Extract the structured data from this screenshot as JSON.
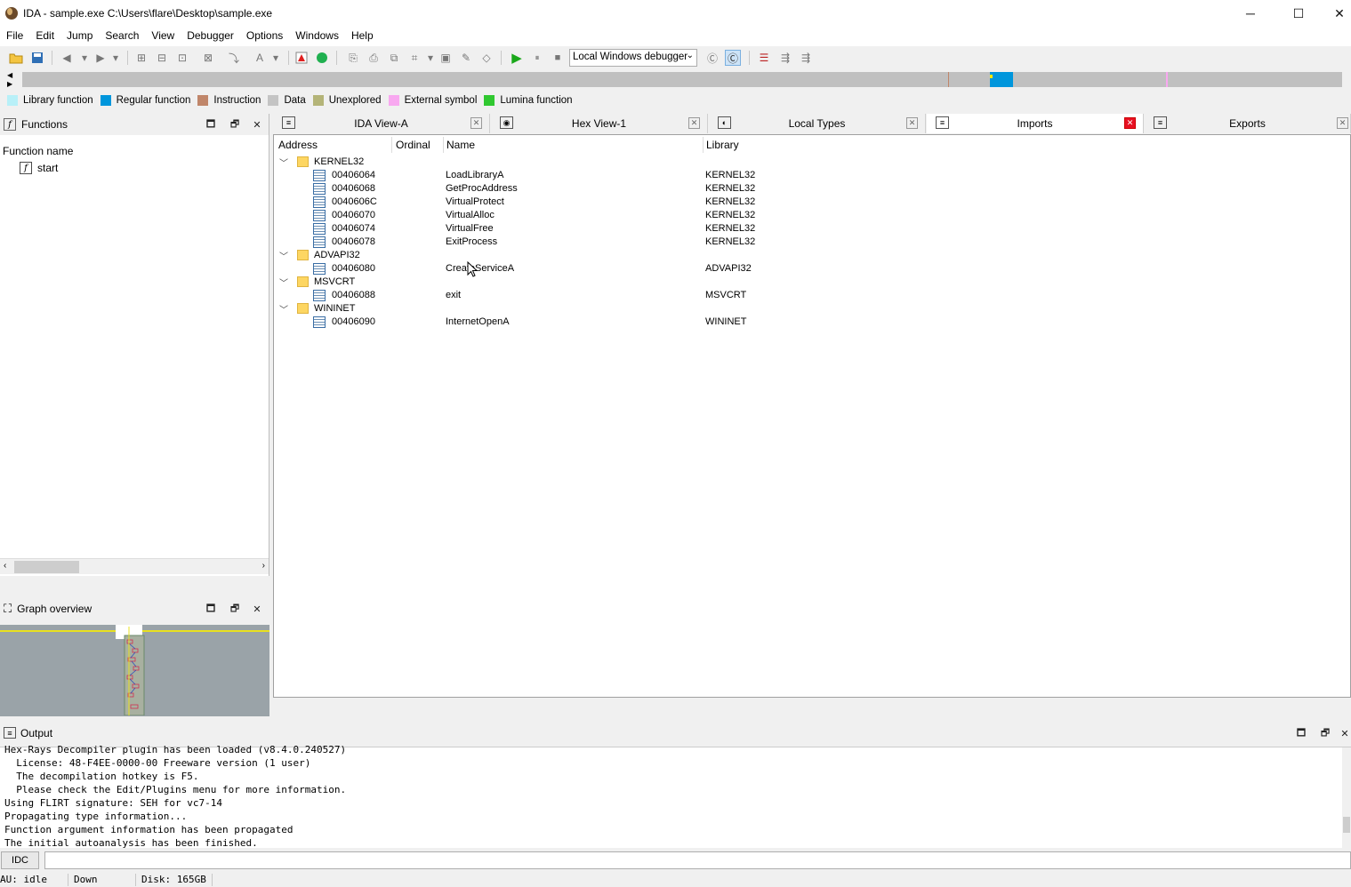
{
  "window": {
    "title": "IDA - sample.exe C:\\Users\\flare\\Desktop\\sample.exe",
    "minimize": "─",
    "maximize": "☐",
    "close": "✕"
  },
  "menu": [
    "File",
    "Edit",
    "Jump",
    "Search",
    "View",
    "Debugger",
    "Options",
    "Windows",
    "Help"
  ],
  "toolbar": {
    "debugger_select": "Local Windows debugger",
    "run_icon": "▶",
    "pause_icon": "⏸",
    "stop_icon": "■"
  },
  "legend": [
    {
      "label": "Library function",
      "color": "#b8f0f8"
    },
    {
      "label": "Regular function",
      "color": "#0096dc"
    },
    {
      "label": "Instruction",
      "color": "#c0866a"
    },
    {
      "label": "Data",
      "color": "#c4c4c4"
    },
    {
      "label": "Unexplored",
      "color": "#b4b478"
    },
    {
      "label": "External symbol",
      "color": "#f8a8f0"
    },
    {
      "label": "Lumina function",
      "color": "#30c830"
    }
  ],
  "functions_panel": {
    "title": "Functions",
    "column": "Function name",
    "items": [
      "start"
    ]
  },
  "graph_panel": {
    "title": "Graph overview"
  },
  "tabs": [
    {
      "label": "IDA View-A",
      "icon": "≡"
    },
    {
      "label": "Hex View-1",
      "icon": "◉"
    },
    {
      "label": "Local Types",
      "icon": "◐"
    },
    {
      "label": "Imports",
      "icon": "≡"
    },
    {
      "label": "Exports",
      "icon": "≡"
    }
  ],
  "imports": {
    "columns": [
      "Address",
      "Ordinal",
      "Name",
      "Library"
    ],
    "rows": [
      {
        "type": "group",
        "label": "KERNEL32"
      },
      {
        "type": "item",
        "address": "00406064",
        "name": "LoadLibraryA",
        "library": "KERNEL32"
      },
      {
        "type": "item",
        "address": "00406068",
        "name": "GetProcAddress",
        "library": "KERNEL32"
      },
      {
        "type": "item",
        "address": "0040606C",
        "name": "VirtualProtect",
        "library": "KERNEL32"
      },
      {
        "type": "item",
        "address": "00406070",
        "name": "VirtualAlloc",
        "library": "KERNEL32"
      },
      {
        "type": "item",
        "address": "00406074",
        "name": "VirtualFree",
        "library": "KERNEL32"
      },
      {
        "type": "item",
        "address": "00406078",
        "name": "ExitProcess",
        "library": "KERNEL32"
      },
      {
        "type": "group",
        "label": "ADVAPI32"
      },
      {
        "type": "item",
        "address": "00406080",
        "name": "CreateServiceA",
        "library": "ADVAPI32"
      },
      {
        "type": "group",
        "label": "MSVCRT"
      },
      {
        "type": "item",
        "address": "00406088",
        "name": "exit",
        "library": "MSVCRT"
      },
      {
        "type": "group",
        "label": "WININET"
      },
      {
        "type": "item",
        "address": "00406090",
        "name": "InternetOpenA",
        "library": "WININET"
      }
    ]
  },
  "output": {
    "title": "Output",
    "lines": [
      "Hex-Rays Decompiler plugin has been loaded (v8.4.0.240527)",
      "  License: 48-F4EE-0000-00 Freeware version (1 user)",
      "  The decompilation hotkey is F5.",
      "  Please check the Edit/Plugins menu for more information.",
      "Using FLIRT signature: SEH for vc7-14",
      "Propagating type information...",
      "Function argument information has been propagated",
      "The initial autoanalysis has been finished."
    ]
  },
  "cmdline": {
    "button": "IDC"
  },
  "status": {
    "au": "AU:  idle",
    "direction": "Down",
    "disk": "Disk: 165GB"
  }
}
